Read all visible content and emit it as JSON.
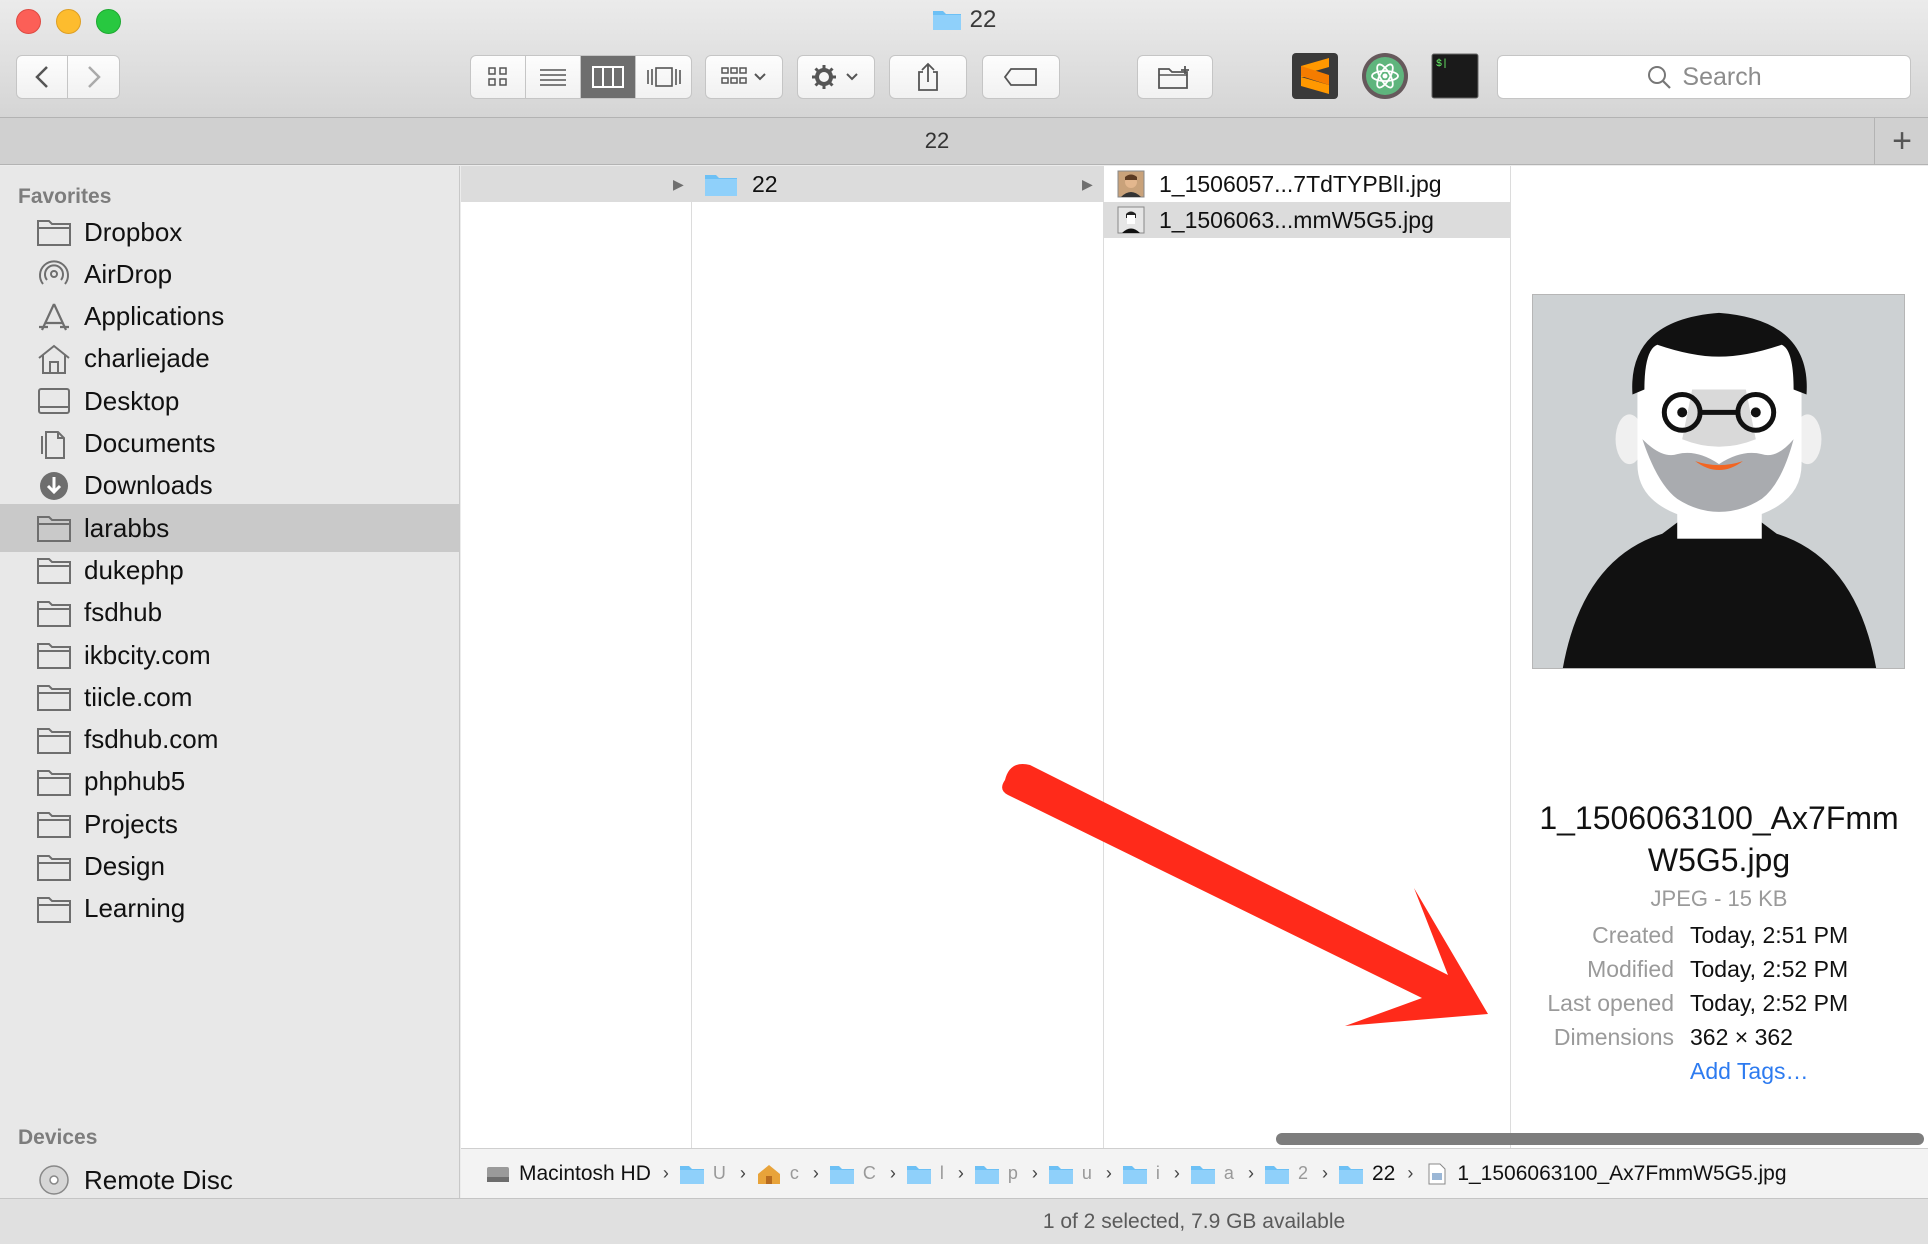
{
  "window": {
    "title": "22"
  },
  "toolbar": {
    "search_placeholder": "Search",
    "view_buttons": [
      "icon-view",
      "list-view",
      "column-view",
      "cover-flow-view"
    ],
    "active_view": "column-view"
  },
  "tabbar": {
    "tab_label": "22",
    "add_tab": "+"
  },
  "sidebar": {
    "favorites_heading": "Favorites",
    "favorites": [
      {
        "label": "Dropbox",
        "icon": "folder-icon"
      },
      {
        "label": "AirDrop",
        "icon": "airdrop-icon"
      },
      {
        "label": "Applications",
        "icon": "applications-icon"
      },
      {
        "label": "charliejade",
        "icon": "home-icon"
      },
      {
        "label": "Desktop",
        "icon": "desktop-icon"
      },
      {
        "label": "Documents",
        "icon": "documents-icon"
      },
      {
        "label": "Downloads",
        "icon": "downloads-icon"
      },
      {
        "label": "larabbs",
        "icon": "folder-icon",
        "selected": true
      },
      {
        "label": "dukephp",
        "icon": "folder-icon"
      },
      {
        "label": "fsdhub",
        "icon": "folder-icon"
      },
      {
        "label": "ikbcity.com",
        "icon": "folder-icon"
      },
      {
        "label": "tiicle.com",
        "icon": "folder-icon"
      },
      {
        "label": "fsdhub.com",
        "icon": "folder-icon"
      },
      {
        "label": "phphub5",
        "icon": "folder-icon"
      },
      {
        "label": "Projects",
        "icon": "folder-icon"
      },
      {
        "label": "Design",
        "icon": "folder-icon"
      },
      {
        "label": "Learning",
        "icon": "folder-icon"
      }
    ],
    "devices_heading": "Devices",
    "devices": [
      {
        "label": "Remote Disc",
        "icon": "disc-icon"
      }
    ]
  },
  "columns": {
    "col2_folder": "22",
    "files": [
      {
        "name": "1_1506057...7TdTYPBlI.jpg"
      },
      {
        "name": "1_1506063...mmW5G5.jpg",
        "selected": true
      }
    ]
  },
  "preview": {
    "filename": "1_1506063100_Ax7FmmW5G5.jpg",
    "filename_line1": "1_1506063100_Ax7Fmm",
    "filename_line2": "W5G5.jpg",
    "kind": "JPEG - 15 KB",
    "meta": [
      {
        "label": "Created",
        "value": "Today, 2:51 PM"
      },
      {
        "label": "Modified",
        "value": "Today, 2:52 PM"
      },
      {
        "label": "Last opened",
        "value": "Today, 2:52 PM"
      },
      {
        "label": "Dimensions",
        "value": "362 × 362"
      }
    ],
    "add_tags": "Add Tags…"
  },
  "pathbar": {
    "root": "Macintosh HD",
    "abbrev": [
      "U",
      "c",
      "C",
      "l",
      "p",
      "u",
      "i",
      "a",
      "2"
    ],
    "folder": "22",
    "file": "1_1506063100_Ax7FmmW5G5.jpg"
  },
  "status": {
    "text": "1 of 2 selected, 7.9 GB available"
  },
  "colors": {
    "arrow": "#ff2a1a",
    "selection": "#c9c9c9",
    "link": "#2d7bf0",
    "folder": "#6cc0f5"
  }
}
